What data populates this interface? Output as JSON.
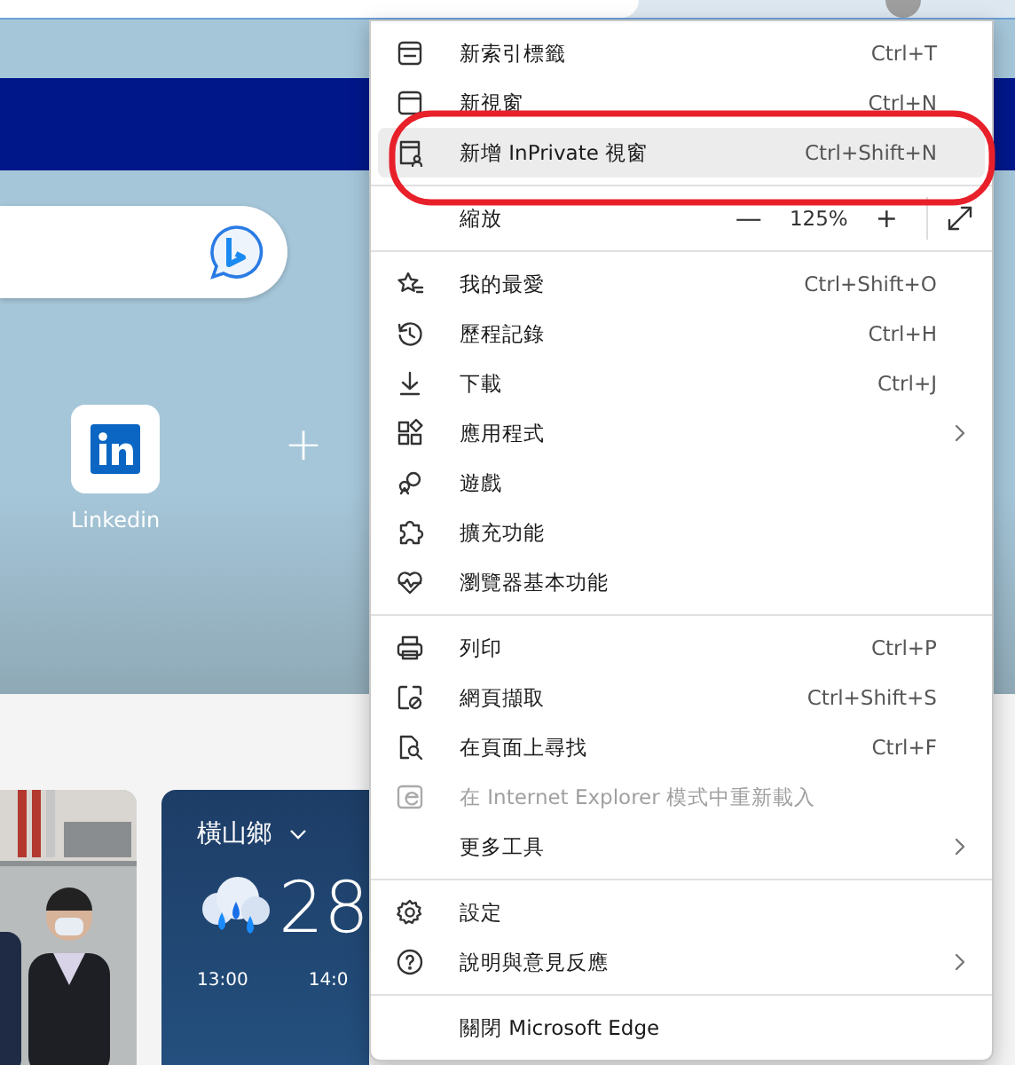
{
  "page": {
    "quick_links": [
      {
        "label": "Linkedin"
      }
    ],
    "add_tile": "+",
    "weather": {
      "location": "橫山鄉",
      "temperature": "28",
      "hours": [
        "13:00",
        "14:0"
      ]
    }
  },
  "menu": {
    "sections": [
      {
        "items": [
          {
            "kind": "command",
            "label": "新索引標籤",
            "shortcut": "Ctrl+T",
            "submenu": false,
            "disabled": false,
            "selected": false
          },
          {
            "kind": "command",
            "label": "新視窗",
            "shortcut": "Ctrl+N",
            "submenu": false,
            "disabled": false,
            "selected": false
          },
          {
            "kind": "command",
            "label": "新增 InPrivate 視窗",
            "shortcut": "Ctrl+Shift+N",
            "submenu": false,
            "disabled": false,
            "selected": true
          }
        ]
      },
      {
        "items": [
          {
            "kind": "zoom",
            "label": "縮放",
            "minus": "—",
            "value": "125%",
            "plus": "+",
            "selected": false
          }
        ]
      },
      {
        "items": [
          {
            "kind": "command",
            "label": "我的最愛",
            "shortcut": "Ctrl+Shift+O",
            "submenu": false,
            "disabled": false,
            "selected": false
          },
          {
            "kind": "command",
            "label": "歷程記錄",
            "shortcut": "Ctrl+H",
            "submenu": false,
            "disabled": false,
            "selected": false
          },
          {
            "kind": "command",
            "label": "下載",
            "shortcut": "Ctrl+J",
            "submenu": false,
            "disabled": false,
            "selected": false
          },
          {
            "kind": "command",
            "label": "應用程式",
            "submenu": true,
            "disabled": false,
            "selected": false
          },
          {
            "kind": "command",
            "label": "遊戲",
            "submenu": false,
            "disabled": false,
            "selected": false
          },
          {
            "kind": "command",
            "label": "擴充功能",
            "submenu": false,
            "disabled": false,
            "selected": false
          },
          {
            "kind": "command",
            "label": "瀏覽器基本功能",
            "submenu": false,
            "disabled": false,
            "selected": false
          }
        ]
      },
      {
        "items": [
          {
            "kind": "command",
            "label": "列印",
            "shortcut": "Ctrl+P",
            "submenu": false,
            "disabled": false,
            "selected": false
          },
          {
            "kind": "command",
            "label": "網頁擷取",
            "shortcut": "Ctrl+Shift+S",
            "submenu": false,
            "disabled": false,
            "selected": false
          },
          {
            "kind": "command",
            "label": "在頁面上尋找",
            "shortcut": "Ctrl+F",
            "submenu": false,
            "disabled": false,
            "selected": false
          },
          {
            "kind": "command",
            "label": "在 Internet Explorer 模式中重新載入",
            "submenu": false,
            "disabled": true,
            "selected": false
          },
          {
            "kind": "command",
            "label": "更多工具",
            "submenu": true,
            "disabled": false,
            "selected": false
          }
        ]
      },
      {
        "items": [
          {
            "kind": "command",
            "label": "設定",
            "submenu": false,
            "disabled": false,
            "selected": false
          },
          {
            "kind": "command",
            "label": "說明與意見反應",
            "submenu": true,
            "disabled": false,
            "selected": false
          }
        ]
      },
      {
        "items": [
          {
            "kind": "command",
            "label": "關閉 Microsoft Edge",
            "submenu": false,
            "disabled": false,
            "selected": false
          }
        ]
      }
    ]
  }
}
